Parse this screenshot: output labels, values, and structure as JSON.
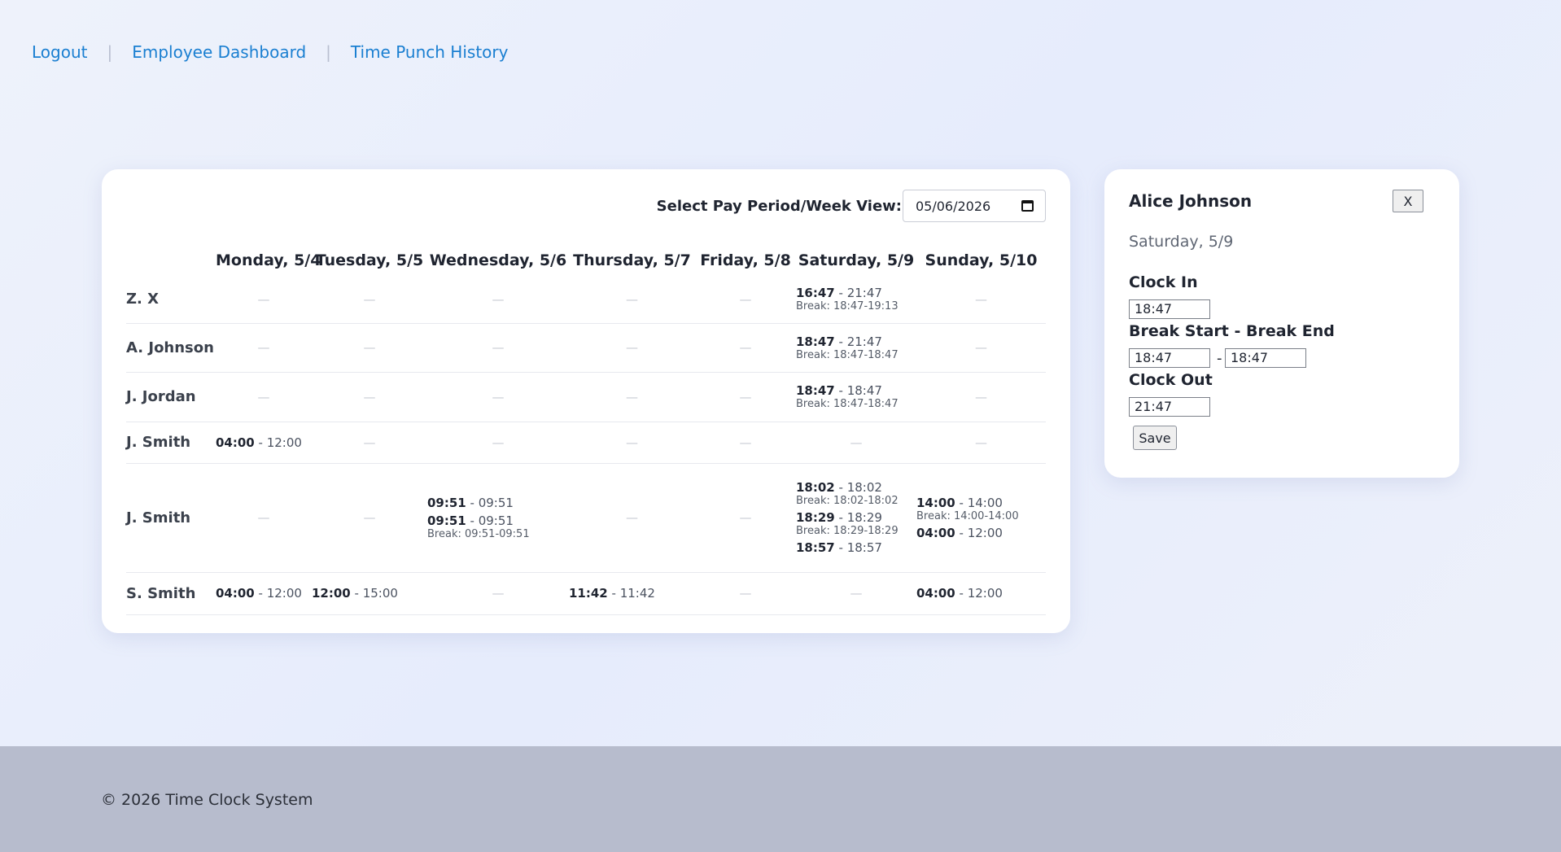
{
  "nav": {
    "logout": "Logout",
    "dashboard": "Employee Dashboard",
    "history": "Time Punch History",
    "separator": "|"
  },
  "schedule": {
    "period_label": "Select Pay Period/Week View:",
    "date_value": "05/06/2026",
    "days": [
      "Monday, 5/4",
      "Tuesday, 5/5",
      "Wednesday, 5/6",
      "Thursday, 5/7",
      "Friday, 5/8",
      "Saturday, 5/9",
      "Sunday, 5/10"
    ],
    "rows": [
      {
        "name": "Z. X",
        "cells": [
          [],
          [],
          [],
          [],
          [],
          [
            {
              "in": "16:47",
              "out": "21:47",
              "break": "Break: 18:47-19:13"
            }
          ],
          []
        ]
      },
      {
        "name": "A. Johnson",
        "cells": [
          [],
          [],
          [],
          [],
          [],
          [
            {
              "in": "18:47",
              "out": "21:47",
              "break": "Break: 18:47-18:47"
            }
          ],
          []
        ]
      },
      {
        "name": "J. Jordan",
        "cells": [
          [],
          [],
          [],
          [],
          [],
          [
            {
              "in": "18:47",
              "out": "18:47",
              "break": "Break: 18:47-18:47"
            }
          ],
          []
        ]
      },
      {
        "name": "J. Smith",
        "cells": [
          [
            {
              "in": "04:00",
              "out": "12:00"
            }
          ],
          [],
          [],
          [],
          [],
          [],
          []
        ]
      },
      {
        "name": "J. Smith",
        "cells": [
          [],
          [],
          [
            {
              "in": "09:51",
              "out": "09:51"
            },
            {
              "in": "09:51",
              "out": "09:51",
              "break": "Break: 09:51-09:51"
            }
          ],
          [],
          [],
          [
            {
              "in": "18:02",
              "out": "18:02",
              "break": "Break: 18:02-18:02"
            },
            {
              "in": "18:29",
              "out": "18:29",
              "break": "Break: 18:29-18:29"
            },
            {
              "in": "18:57",
              "out": "18:57"
            }
          ],
          [
            {
              "in": "14:00",
              "out": "14:00",
              "break": "Break: 14:00-14:00"
            },
            {
              "in": "04:00",
              "out": "12:00"
            }
          ]
        ]
      },
      {
        "name": "S. Smith",
        "cells": [
          [
            {
              "in": "04:00",
              "out": "12:00"
            }
          ],
          [
            {
              "in": "12:00",
              "out": "15:00"
            }
          ],
          [],
          [
            {
              "in": "11:42",
              "out": "11:42"
            }
          ],
          [],
          [],
          [
            {
              "in": "04:00",
              "out": "12:00"
            }
          ]
        ]
      }
    ]
  },
  "detail": {
    "name": "Alice Johnson",
    "close_label": "X",
    "day": "Saturday, 5/9",
    "clock_in_label": "Clock In",
    "clock_in": "18:47",
    "break_label": "Break Start - Break End",
    "break_start": "18:47",
    "break_end": "18:47",
    "break_sep": "-",
    "clock_out_label": "Clock Out",
    "clock_out": "21:47",
    "save_label": "Save"
  },
  "footer": {
    "copyright": "© 2026 Time Clock System"
  }
}
